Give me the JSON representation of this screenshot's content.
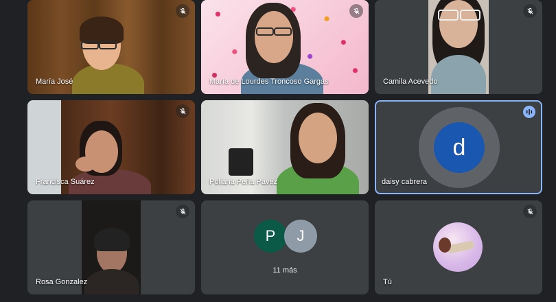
{
  "tiles": [
    {
      "name": "María José"
    },
    {
      "name": "María de Lourdes Troncoso Gargas"
    },
    {
      "name": "Camila Acevedo"
    },
    {
      "name": "Francisca Suárez"
    },
    {
      "name": "Poliana Peña Pavez"
    },
    {
      "name": "daisy cabrera",
      "avatar_letter": "d"
    },
    {
      "name": "Rosa Gonzalez"
    },
    {
      "more_avatars": [
        "P",
        "J"
      ],
      "more_label": "11 más"
    },
    {
      "name": "Tú"
    }
  ],
  "colors": {
    "background": "#202124",
    "tile": "#3c4043",
    "active_border": "#8ab4f8",
    "avatar_d": "#1a57b0",
    "avatar_p": "#0b5a48",
    "avatar_j": "#8f9ba6"
  },
  "icons": {
    "mute": "mic-off-icon",
    "speaking": "audio-bars-icon"
  }
}
